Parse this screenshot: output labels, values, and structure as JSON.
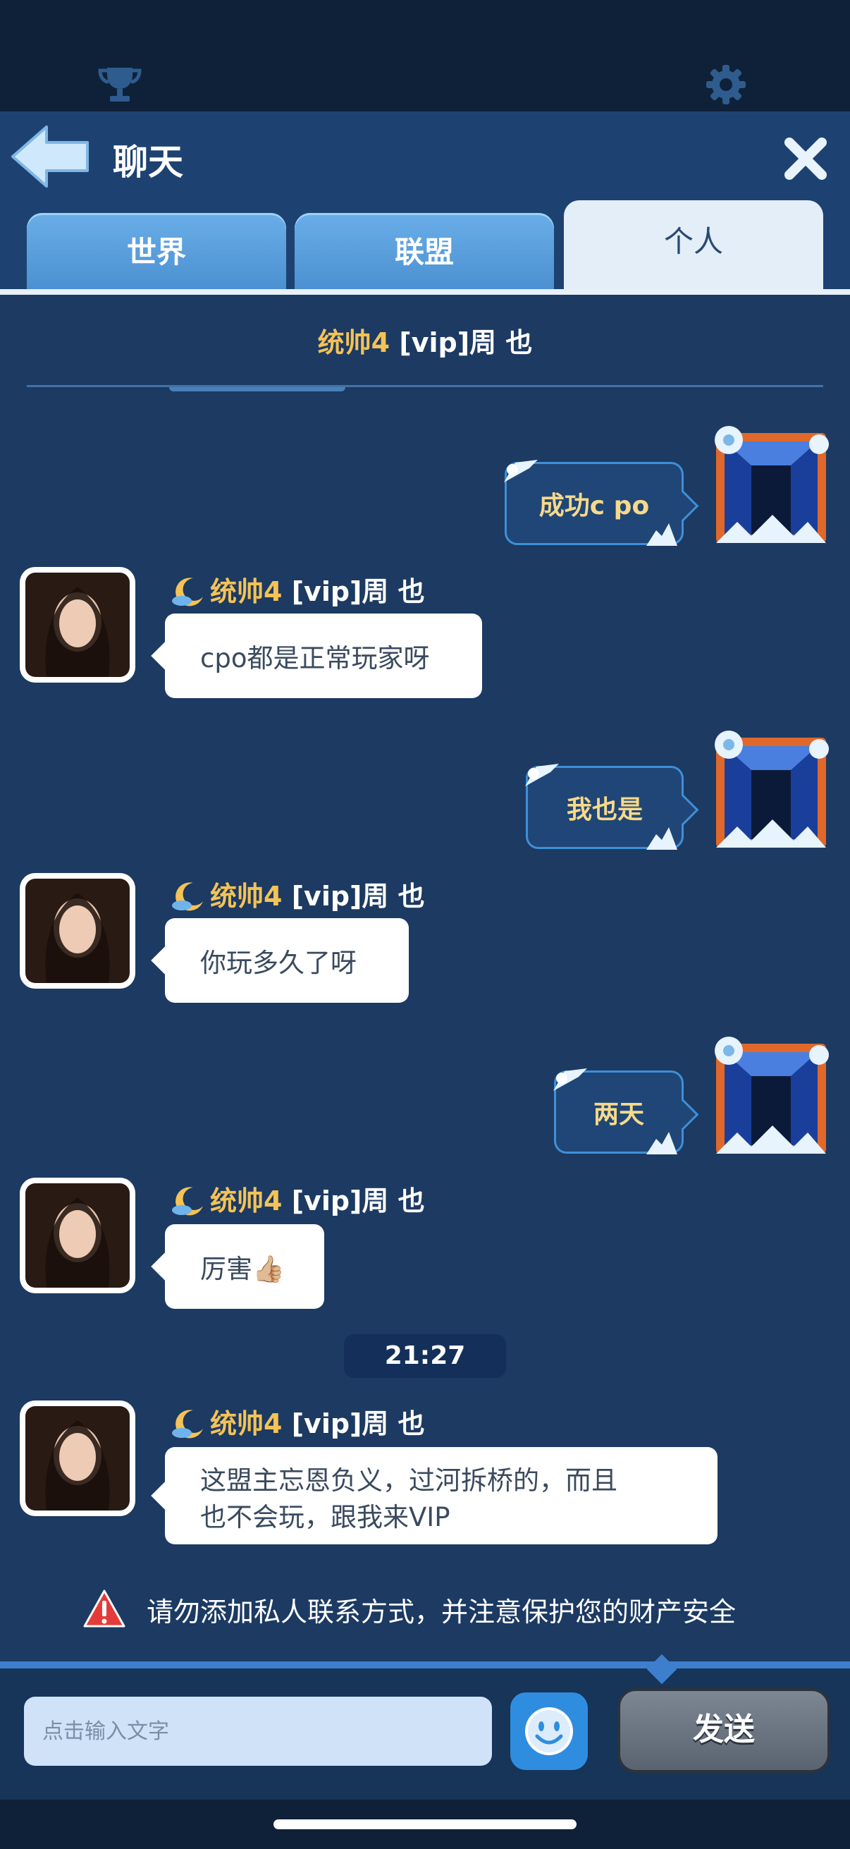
{
  "header": {
    "title": "聊天"
  },
  "tabs": [
    {
      "label": "世界",
      "active": false
    },
    {
      "label": "联盟",
      "active": false
    },
    {
      "label": "个人",
      "active": true
    }
  ],
  "peer": {
    "rank": "统帅4",
    "vip": "[vip]",
    "name": "周 也"
  },
  "messages": [
    {
      "direction": "out",
      "text": "成功c po"
    },
    {
      "direction": "in",
      "rank": "统帅4",
      "vip": "[vip]",
      "name": "周 也",
      "text": "cpo都是正常玩家呀"
    },
    {
      "direction": "out",
      "text": "我也是"
    },
    {
      "direction": "in",
      "rank": "统帅4",
      "vip": "[vip]",
      "name": "周 也",
      "text": "你玩多久了呀"
    },
    {
      "direction": "out",
      "text": "两天"
    },
    {
      "direction": "in",
      "rank": "统帅4",
      "vip": "[vip]",
      "name": "周 也",
      "text": "厉害👍🏼"
    },
    {
      "direction": "in",
      "rank": "统帅4",
      "vip": "[vip]",
      "name": "周 也",
      "line1": "这盟主忘恩负义，过河拆桥的，而且",
      "line2": "也不会玩，跟我来VIP"
    }
  ],
  "timestamp": "21:27",
  "warning": "请勿添加私人联系方式，并注意保护您的财产安全",
  "input": {
    "placeholder": "点击输入文字"
  },
  "send_label": "发送",
  "colors": {
    "gold": "#f4c256",
    "bubble_out_text": "#f7d98a",
    "background": "#1c3a62"
  }
}
